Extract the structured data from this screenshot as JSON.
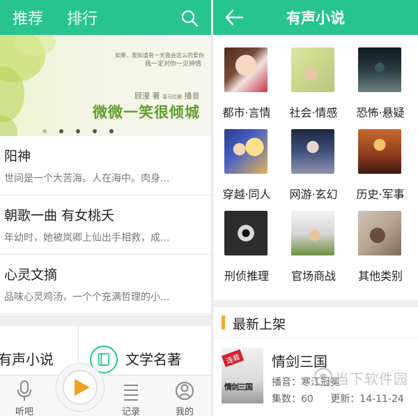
{
  "left": {
    "tabs": [
      "推荐",
      "排行"
    ],
    "banner": {
      "line1": "如果，我知道有一天我会这么的爱你",
      "line2": "我一定对你一见钟情",
      "author": "顾漫",
      "author_suffix": "著",
      "narrator_small": "喜马拉雅",
      "narrate": "播音",
      "title": "微微一笑很倾城"
    },
    "books": [
      {
        "title": "阳神",
        "desc": "世间是一个大苦海。人在海中。肉身..."
      },
      {
        "title": "朝歌一曲 有女桃夭",
        "desc": "年幼时，她被岚卿上仙出手相救，成..."
      },
      {
        "title": "心灵文摘",
        "desc": "品味心灵鸡汤，一个个充满哲理的小..."
      }
    ],
    "quick_categories": [
      "有声小说",
      "文学名著"
    ],
    "nav": {
      "listen": "听吧",
      "records": "记录",
      "mine": "我的"
    }
  },
  "right": {
    "title": "有声小说",
    "categories": [
      "都市·言情",
      "社会·情感",
      "恐怖·悬疑",
      "穿越·同人",
      "网游·玄幻",
      "历史·军事",
      "刑侦推理",
      "官场商战",
      "其他类别"
    ],
    "latest": {
      "heading": "最新上架",
      "badge": "连载",
      "cover_title": "情剑三国",
      "name": "情剑三国",
      "narrator": "播音：寒江冠冕",
      "episodes": "集数：60",
      "updated": "更新：14-11-24"
    }
  },
  "watermark": "当下软件园",
  "colors": {
    "primary": "#27c490",
    "accent": "#f0a92e",
    "play": "#f0a020"
  }
}
